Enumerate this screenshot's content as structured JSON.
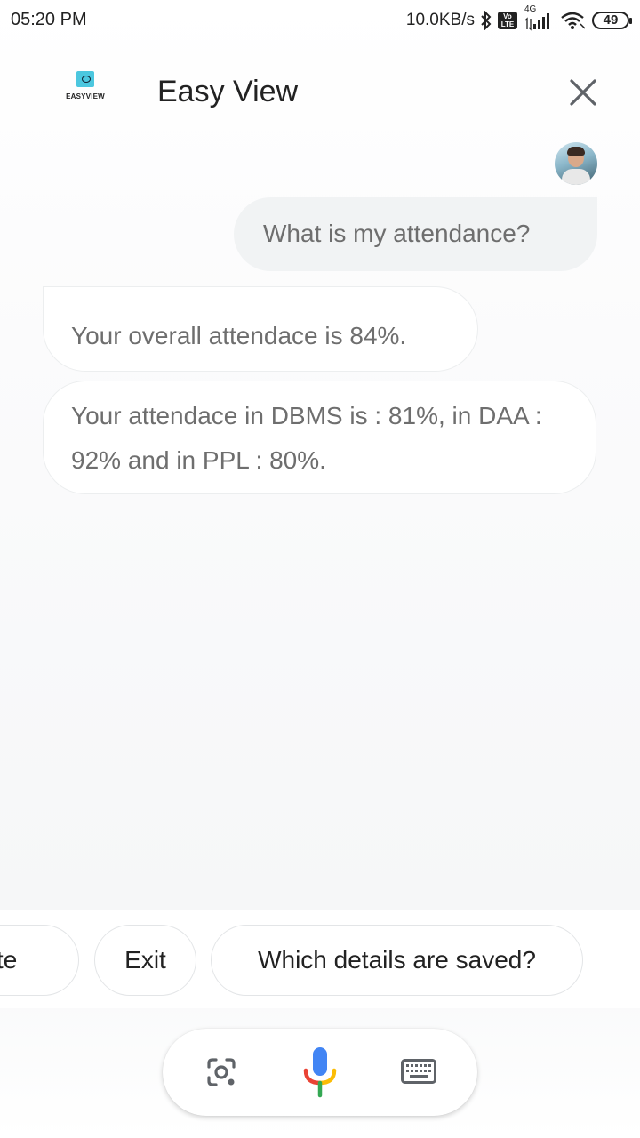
{
  "status_bar": {
    "time": "05:20 PM",
    "speed": "10.0KB/s",
    "network": "4G",
    "volte_top": "Vo",
    "volte_bottom": "LTE",
    "battery": "49"
  },
  "header": {
    "logo_text": "EASYVIEW",
    "title": "Easy View",
    "close_icon": "close-icon"
  },
  "chat": {
    "user_message": "What is my attendance?",
    "replies": [
      "Your overall attendace is 84%.",
      "Your attendace in DBMS is : 81%, in DAA : 92% and in PPL : 80%."
    ]
  },
  "suggestions": [
    "Quote",
    "Exit",
    "Which details are saved?"
  ],
  "action_bar": {
    "left_icon": "lens-icon",
    "center_icon": "mic-icon",
    "right_icon": "keyboard-icon"
  },
  "colors": {
    "accent_blue": "#4285F4",
    "accent_red": "#EA4335",
    "accent_yellow": "#FBBC05",
    "accent_green": "#34A853",
    "bubble_gray": "#f1f3f4",
    "text_gray": "#6e6e6e"
  }
}
